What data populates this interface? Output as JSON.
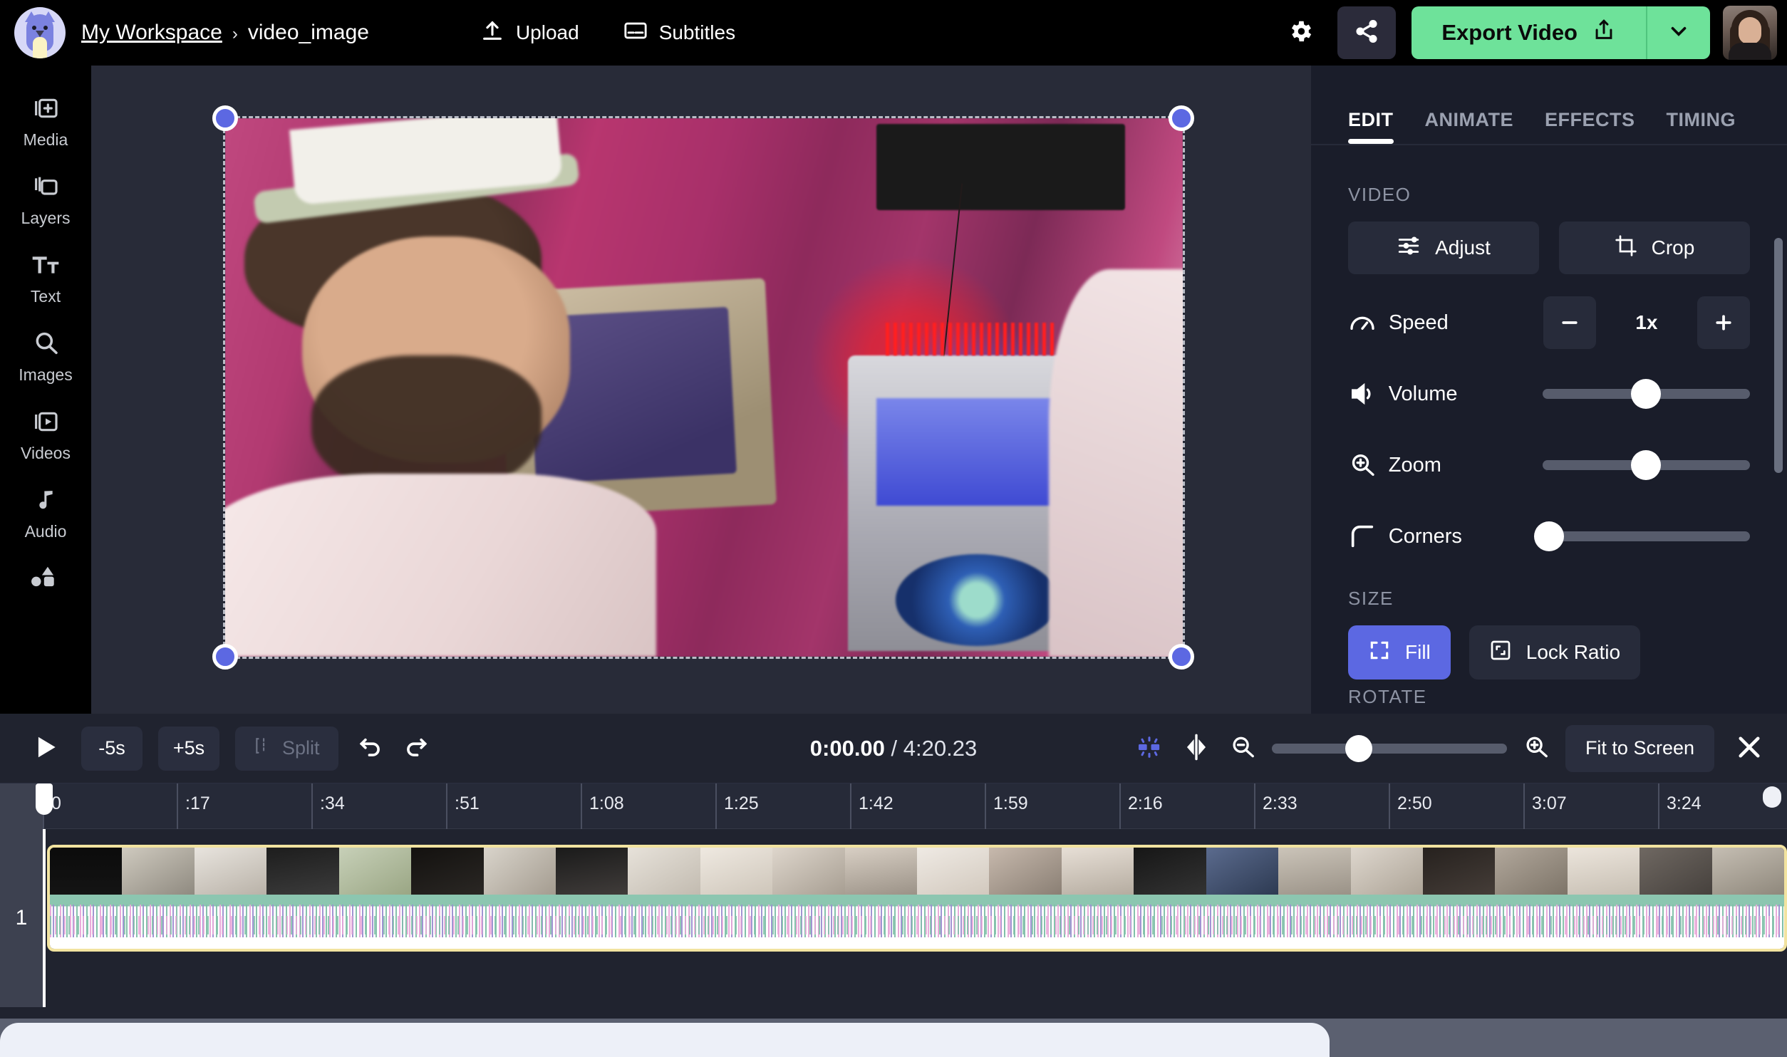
{
  "header": {
    "workspace": "My Workspace",
    "separator": "›",
    "project": "video_image",
    "upload_label": "Upload",
    "subtitles_label": "Subtitles",
    "export_label": "Export Video",
    "icons": {
      "logo": "cat-avatar-logo",
      "upload": "upload-icon",
      "subtitles": "subtitles-icon",
      "settings": "gear-icon",
      "share": "share-icon",
      "export": "share-export-icon",
      "caret": "chevron-down-icon",
      "avatar": "user-avatar"
    }
  },
  "sidebar": {
    "items": [
      {
        "label": "Media",
        "icon": "media-add-icon"
      },
      {
        "label": "Layers",
        "icon": "layers-icon"
      },
      {
        "label": "Text",
        "icon": "text-icon"
      },
      {
        "label": "Images",
        "icon": "search-images-icon"
      },
      {
        "label": "Videos",
        "icon": "video-play-icon"
      },
      {
        "label": "Audio",
        "icon": "music-note-icon"
      },
      {
        "label": "",
        "icon": "shapes-icon"
      }
    ]
  },
  "canvas": {
    "selection": "video-selection-box",
    "handles": [
      "top-left",
      "top-right",
      "bottom-left",
      "bottom-right"
    ],
    "rotate_icon": "rotate-icon",
    "accent_color": "#5c68e2"
  },
  "right_panel": {
    "tabs": [
      {
        "label": "EDIT",
        "active": true
      },
      {
        "label": "ANIMATE",
        "active": false
      },
      {
        "label": "EFFECTS",
        "active": false
      },
      {
        "label": "TIMING",
        "active": false
      }
    ],
    "video_section": {
      "title": "VIDEO",
      "adjust_label": "Adjust",
      "crop_label": "Crop",
      "controls": [
        {
          "name": "Speed",
          "icon": "speedometer-icon",
          "type": "stepper",
          "value": "1x"
        },
        {
          "name": "Volume",
          "icon": "volume-icon",
          "type": "slider",
          "percent": 50
        },
        {
          "name": "Zoom",
          "icon": "zoom-in-icon",
          "type": "slider",
          "percent": 50
        },
        {
          "name": "Corners",
          "icon": "corner-radius-icon",
          "type": "slider",
          "percent": 3
        }
      ]
    },
    "size_section": {
      "title": "SIZE",
      "fill_label": "Fill",
      "lock_ratio_label": "Lock Ratio",
      "fill_active_color": "#5c68e2"
    },
    "rotate_section": {
      "title": "ROTATE"
    }
  },
  "timeline": {
    "toolbar": {
      "play_icon": "play-icon",
      "back5_label": "-5s",
      "forward5_label": "+5s",
      "split_label": "Split",
      "split_icon": "split-icon",
      "undo_icon": "undo-icon",
      "redo_icon": "redo-icon",
      "current_time": "0:00.00",
      "time_divider": "/",
      "total_time": "4:20.23",
      "snap_icon": "snap-icon",
      "flip_icon": "flip-icon",
      "zoom_out_icon": "zoom-out-icon",
      "zoom_in_icon": "zoom-in-icon",
      "zoom_percent": 37,
      "fit_label": "Fit to Screen",
      "close_icon": "close-icon"
    },
    "ruler_ticks": [
      "0",
      ":17",
      ":34",
      ":51",
      "1:08",
      "1:25",
      "1:42",
      "1:59",
      "2:16",
      "2:33",
      "2:50",
      "3:07",
      "3:24"
    ],
    "track": {
      "number": "1",
      "clip_border_color": "#f2e3a0",
      "waveform_colors": [
        "#8cc6b0",
        "#e8a8d8",
        "#9b8fd0"
      ],
      "thumbnails": [
        "#0a0a0a",
        "#cfcabf",
        "#e6e2dc",
        "#d6d2cb",
        "#171717",
        "#c9c4ba",
        "#0d0d0d",
        "#151515",
        "#d7d2c9",
        "#dedad2",
        "#2a2a2a",
        "#1a1a1a",
        "#c8c2b8",
        "#e2ded6",
        "#b9b3a8",
        "#151515",
        "#4a4a4a",
        "#d2cdc4",
        "#ddd8cf",
        "#221f1d",
        "#b0a79c",
        "#e8e3da",
        "#6b6560",
        "#c1bbb1"
      ]
    },
    "playhead_position": "0:00.00"
  }
}
